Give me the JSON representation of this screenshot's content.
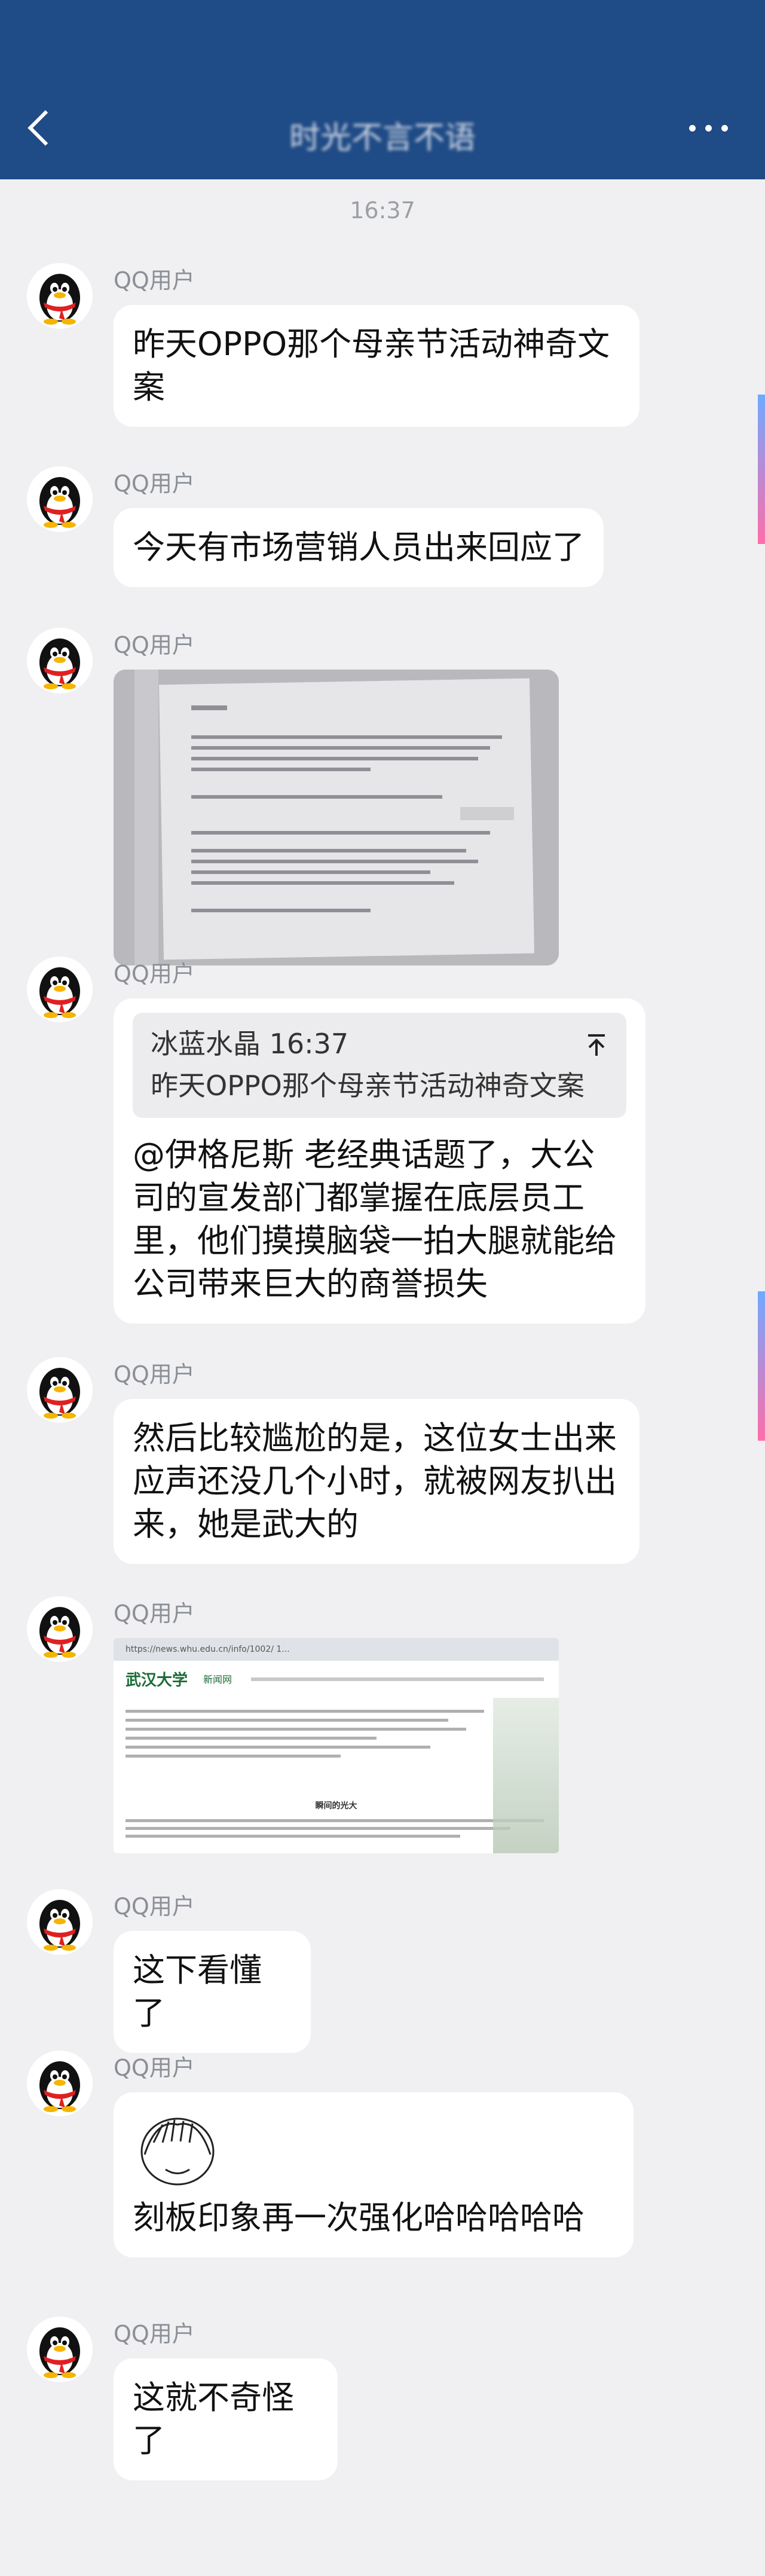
{
  "header": {
    "title": "时光不言不语"
  },
  "timestamp": "16:37",
  "messages": [
    {
      "sender": "QQ用户",
      "text": "昨天OPPO那个母亲节活动神奇文案"
    },
    {
      "sender": "QQ用户",
      "text": "今天有市场营销人员出来回应了"
    },
    {
      "sender": "QQ用户",
      "image": "screenshot-photo-of-comments"
    },
    {
      "sender": "QQ用户",
      "quote": {
        "author": "冰蓝水晶 16:37",
        "text": "昨天OPPO那个母亲节活动神奇文案"
      },
      "text": "@伊格尼斯 老经典话题了，大公司的宣发部门都掌握在底层员工里，他们摸摸脑袋一拍大腿就能给公司带来巨大的商誉损失"
    },
    {
      "sender": "QQ用户",
      "text": "然后比较尴尬的是，这位女士出来应声还没几个小时，就被网友扒出来，她是武大的"
    },
    {
      "sender": "QQ用户",
      "image": "university-news-webpage"
    },
    {
      "sender": "QQ用户",
      "text": "这下看懂了"
    },
    {
      "sender": "QQ用户",
      "sticker": "covering-face-sticker",
      "text": "刻板印象再一次强化哈哈哈哈哈"
    },
    {
      "sender": "QQ用户",
      "text": "这就不奇怪了"
    }
  ],
  "webpage": {
    "url": "https://news.whu.edu.cn/info/1002/ 1...",
    "logo": "武汉大学",
    "site": "新闻网",
    "heading": "瞬间的光大"
  }
}
